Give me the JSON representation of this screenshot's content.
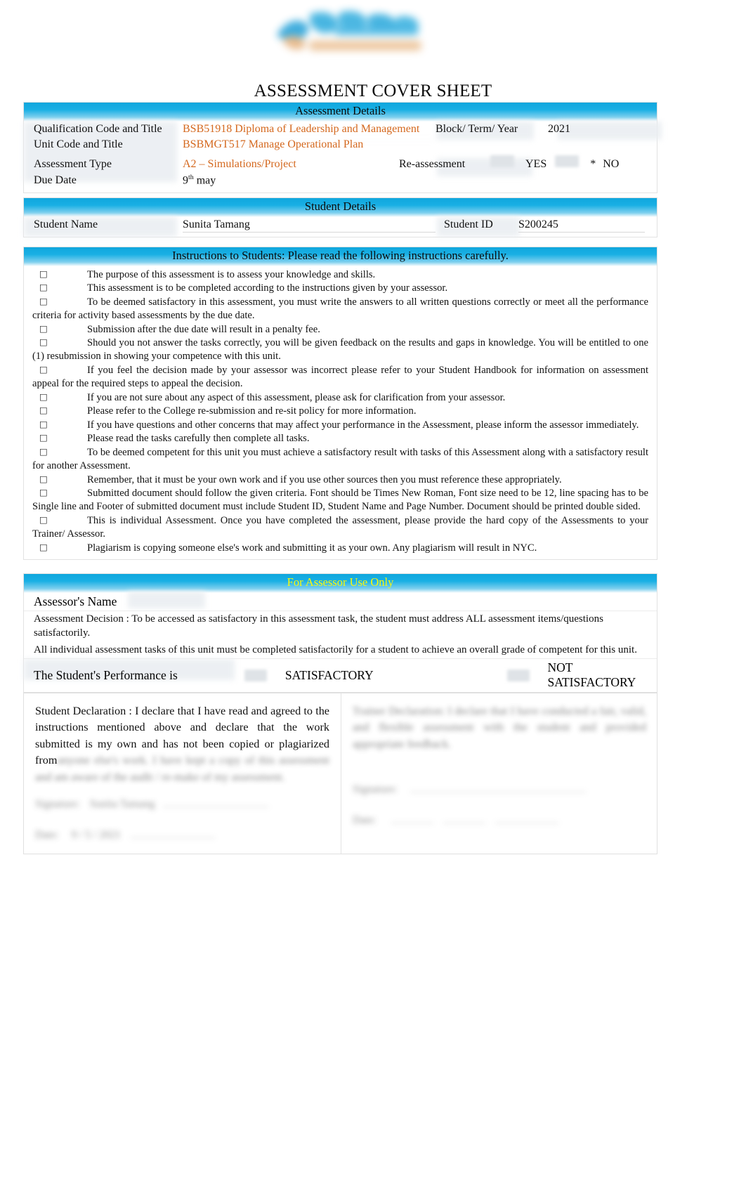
{
  "document": {
    "title": "ASSESSMENT COVER SHEET",
    "logo_alt": "skyline-college-logo"
  },
  "assessment_details": {
    "band_title": "Assessment Details",
    "rows": [
      {
        "label": "Qualification Code and Title",
        "value": "BSB51918 Diploma of Leadership and Management",
        "extra_label": "Block/ Term/ Year",
        "extra_value": "2021"
      },
      {
        "label": "Unit Code and Title",
        "value": "BSBMGT517 Manage Operational Plan",
        "extra_label": "",
        "extra_value": ""
      },
      {
        "label": "Assessment Type",
        "value": "A2 – Simulations/Project",
        "extra_label": "Re-assessment",
        "yes_label": "YES",
        "star": "*",
        "no_label": "NO"
      },
      {
        "label": "Due Date",
        "value": "9",
        "value_sup": "th",
        "value_tail": " may"
      }
    ]
  },
  "student_details": {
    "band_title": "Student Details",
    "name_label": "Student Name",
    "name_value": "Sunita Tamang",
    "id_label": "Student ID",
    "id_value": "S200245"
  },
  "instructions": {
    "band_title": "Instructions to Students:   Please read the following instructions carefully.",
    "items": [
      "The purpose of this assessment is to assess your knowledge and skills.",
      "This assessment is to be completed according to the instructions given by your assessor.",
      "To be deemed satisfactory in this assessment, you must write the answers to all written questions correctly or meet all the performance criteria for activity based assessments by the due date.",
      "Submission after the due date will result in a penalty fee.",
      "Should you not answer the tasks correctly, you will be given feedback on the results and gaps in knowledge. You will be entitled to one (1) resubmission in showing your competence with this unit.",
      "If you feel the decision made by your assessor was incorrect please refer to your Student Handbook for information on assessment appeal for the required steps to appeal the decision.",
      "If you are not sure about any aspect of this assessment, please ask for clarification from your assessor.",
      "Please refer to the College re-submission and re-sit policy for more information.",
      "If you have questions and other concerns that may affect your performance in the Assessment, please inform the assessor immediately.",
      "Please read the tasks carefully then complete all tasks.",
      "To be deemed competent for this unit you must achieve a satisfactory result with tasks of this Assessment along with a satisfactory result for another Assessment.",
      "Remember, that it must be your own work and if you use other sources then you must reference these appropriately.",
      "Submitted document should follow the given criteria. Font should be Times New Roman, Font size need to be 12, line spacing has to be Single line and Footer of submitted document must include Student ID, Student Name and Page Number. Document should be printed double sided.",
      "This is individual Assessment. Once you have completed the assessment, please provide the hard copy of the Assessments to your Trainer/ Assessor.",
      "Plagiarism is copying someone else's work and submitting it as your own. Any plagiarism will result in NYC."
    ],
    "bullet_glyph": "□"
  },
  "assessor": {
    "band_title": "For Assessor Use Only",
    "name_label": "Assessor's Name",
    "decision_paragraph_1": "Assessment Decision : To be accessed as satisfactory in this assessment task, the student must address ALL assessment items/questions satisfactorily.",
    "decision_paragraph_2": "All individual assessment tasks of this unit must be completed satisfactorily for a student to achieve an overall grade of competent for this unit.",
    "performance_label": "The Student's Performance is",
    "satisfactory_label": "SATISFACTORY",
    "not_satisfactory_label": "NOT SATISFACTORY"
  },
  "declaration": {
    "left": {
      "heading": "Student Declaration :",
      "body_visible": " I declare that I have read and agreed to the instructions mentioned above and declare that the work submitted is my own and has not been copied or plagiarized from",
      "body_obscured": "anyone else's work. I have kept a copy of this assessment and am aware of the audit / re-make of my assessment.",
      "signature_label": "Signature:",
      "signature_value": "Sunita Tamang",
      "date_label": "Date:",
      "date_value": "9 / 5 / 2021"
    },
    "right": {
      "heading": "Trainer Declaration:",
      "body_obscured": "I declare that I have conducted a fair, valid, and flexible assessment with the student and provided appropriate feedback.",
      "signature_label": "Signature:",
      "date_label": "Date:"
    }
  },
  "colors": {
    "band_blue": "#1ab0e4",
    "accent_orange": "#d4681e",
    "assessor_yellow": "#f9f80d",
    "text": "#111111"
  }
}
